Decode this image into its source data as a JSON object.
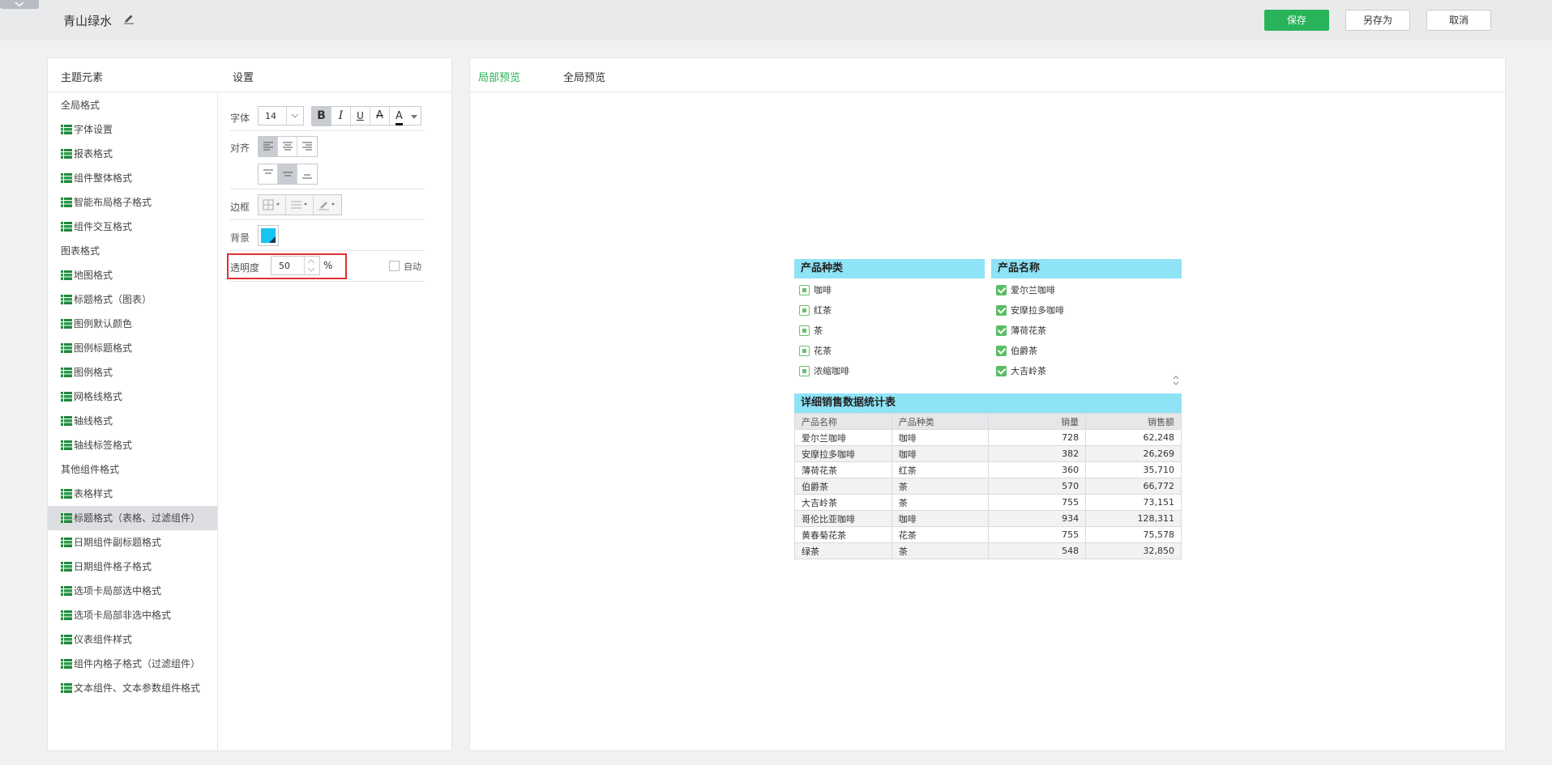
{
  "header": {
    "title": "青山绿水",
    "save_label": "保存",
    "saveas_label": "另存为",
    "cancel_label": "取消"
  },
  "left_panel": {
    "col1_title": "主题元素",
    "col2_title": "设置"
  },
  "tree": [
    {
      "label": "全局格式",
      "type": "group"
    },
    {
      "label": "字体设置",
      "type": "child"
    },
    {
      "label": "报表格式",
      "type": "child"
    },
    {
      "label": "组件整体格式",
      "type": "child"
    },
    {
      "label": "智能布局格子格式",
      "type": "child"
    },
    {
      "label": "组件交互格式",
      "type": "child"
    },
    {
      "label": "图表格式",
      "type": "group"
    },
    {
      "label": "地图格式",
      "type": "child"
    },
    {
      "label": "标题格式（图表）",
      "type": "child"
    },
    {
      "label": "图例默认颜色",
      "type": "child"
    },
    {
      "label": "图例标题格式",
      "type": "child"
    },
    {
      "label": "图例格式",
      "type": "child"
    },
    {
      "label": "网格线格式",
      "type": "child"
    },
    {
      "label": "轴线格式",
      "type": "child"
    },
    {
      "label": "轴线标签格式",
      "type": "child"
    },
    {
      "label": "其他组件格式",
      "type": "group"
    },
    {
      "label": "表格样式",
      "type": "child"
    },
    {
      "label": "标题格式（表格、过滤组件）",
      "type": "child",
      "selected": true
    },
    {
      "label": "日期组件副标题格式",
      "type": "child"
    },
    {
      "label": "日期组件格子格式",
      "type": "child"
    },
    {
      "label": "选项卡局部选中格式",
      "type": "child"
    },
    {
      "label": "选项卡局部非选中格式",
      "type": "child"
    },
    {
      "label": "仪表组件样式",
      "type": "child"
    },
    {
      "label": "组件内格子格式（过滤组件）",
      "type": "child"
    },
    {
      "label": "文本组件、文本参数组件格式",
      "type": "child"
    }
  ],
  "settings": {
    "font_label": "字体",
    "font_size": "14",
    "bold": "B",
    "italic": "I",
    "underline": "U",
    "strike": "A",
    "font_color_glyph": "A",
    "align_label": "对齐",
    "border_label": "边框",
    "bg_label": "背景",
    "bg_color": "#17c3f0",
    "opacity_label": "透明度",
    "opacity_value": "50",
    "opacity_unit": "%",
    "auto_label": "自动"
  },
  "preview": {
    "tab_local": "局部预览",
    "tab_global": "全局预览",
    "accent": "#29b35a",
    "filter1": {
      "title": "产品种类",
      "items": [
        "咖啡",
        "红茶",
        "茶",
        "花茶",
        "浓缩咖啡"
      ]
    },
    "filter2": {
      "title": "产品名称",
      "items": [
        "爱尔兰咖啡",
        "安摩拉多咖啡",
        "薄荷花茶",
        "伯爵茶",
        "大吉岭茶"
      ]
    },
    "table": {
      "title": "详细销售数据统计表",
      "columns": [
        "产品名称",
        "产品种类",
        "销量",
        "销售额"
      ],
      "rows": [
        [
          "爱尔兰咖啡",
          "咖啡",
          "728",
          "62,248"
        ],
        [
          "安摩拉多咖啡",
          "咖啡",
          "382",
          "26,269"
        ],
        [
          "薄荷花茶",
          "红茶",
          "360",
          "35,710"
        ],
        [
          "伯爵茶",
          "茶",
          "570",
          "66,772"
        ],
        [
          "大吉岭茶",
          "茶",
          "755",
          "73,151"
        ],
        [
          "哥伦比亚咖啡",
          "咖啡",
          "934",
          "128,311"
        ],
        [
          "黄春菊花茶",
          "花茶",
          "755",
          "75,578"
        ],
        [
          "绿茶",
          "茶",
          "548",
          "32,850"
        ]
      ]
    }
  }
}
